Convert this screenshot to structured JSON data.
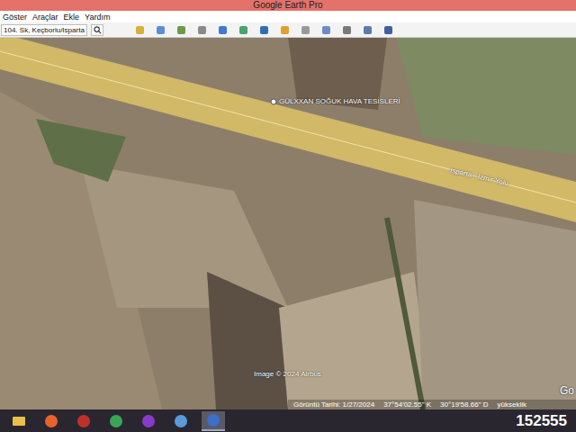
{
  "window": {
    "title": "Google Earth Pro"
  },
  "menu": [
    {
      "label": "Göster"
    },
    {
      "label": "Araçlar"
    },
    {
      "label": "Ekle"
    },
    {
      "label": "Yardım"
    }
  ],
  "search": {
    "value": "104. Sk, Keçborlu/Isparta"
  },
  "map": {
    "places": [
      {
        "label": "GÜLXXAN SOĞUK HAVA TESİSLERİ"
      }
    ],
    "roads": [
      {
        "label": "Isparta - İzmir Yolu"
      }
    ],
    "attribution": "Image © 2024 Airbus",
    "logo": "Go"
  },
  "status_bar": {
    "date": "Görüntü Tarihi: 1/27/2024",
    "lat": "37°54'02.55\" K",
    "lon": "30°19'58.66\" D",
    "elevation": "yükseklik"
  },
  "taskbar": {
    "apps": [
      {
        "kind": "explorer",
        "selected": false
      },
      {
        "kind": "firefox",
        "selected": false
      },
      {
        "kind": "gear",
        "selected": false
      },
      {
        "kind": "chrome",
        "selected": false
      },
      {
        "kind": "purple",
        "selected": false
      },
      {
        "kind": "paint",
        "selected": false
      },
      {
        "kind": "earth",
        "selected": true
      }
    ],
    "clock": "152555"
  }
}
